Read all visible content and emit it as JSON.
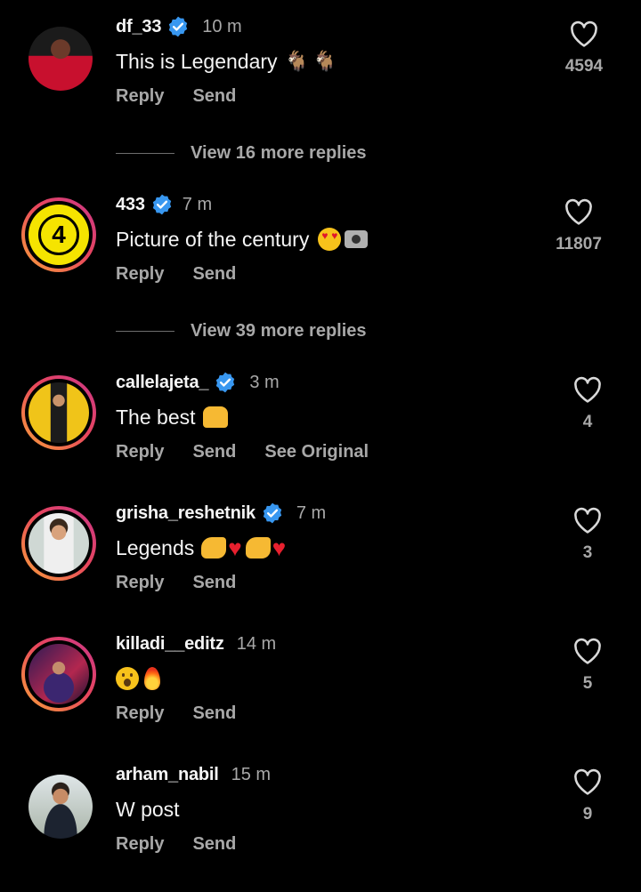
{
  "actions": {
    "reply": "Reply",
    "send": "Send",
    "see_original": "See Original"
  },
  "comments": [
    {
      "username": "df_33",
      "verified": true,
      "time": "10 m",
      "text": "This is Legendary",
      "emoji": "goat-emoji goat-emoji",
      "likes": "4594",
      "more_replies": "View 16 more replies"
    },
    {
      "username": "433",
      "verified": true,
      "time": "7 m",
      "text": "Picture of the century",
      "emoji": "heart-eyes-emoji camera-flash-emoji",
      "likes": "11807",
      "more_replies": "View 39 more replies"
    },
    {
      "username": "callelajeta_",
      "verified": true,
      "time": "3 m",
      "text": "The best",
      "emoji": "raised-hands-emoji",
      "likes": "4"
    },
    {
      "username": "grisha_reshetnik",
      "verified": true,
      "time": "7 m",
      "text": "Legends",
      "emoji": "muscle-emoji red-heart-emoji muscle-emoji red-heart-emoji",
      "likes": "3"
    },
    {
      "username": "killadi__editz",
      "verified": false,
      "time": "14 m",
      "text": "",
      "emoji": "surprised-face-emoji fire-emoji",
      "likes": "5"
    },
    {
      "username": "arham_nabil",
      "verified": false,
      "time": "15 m",
      "text": "W post",
      "emoji": "",
      "likes": "9"
    }
  ],
  "colors": {
    "background": "#000000",
    "primary_text": "#f5f5f5",
    "secondary_text": "#a8a8a8",
    "verified_badge": "#3897f0",
    "story_ring": "#e8465d"
  }
}
